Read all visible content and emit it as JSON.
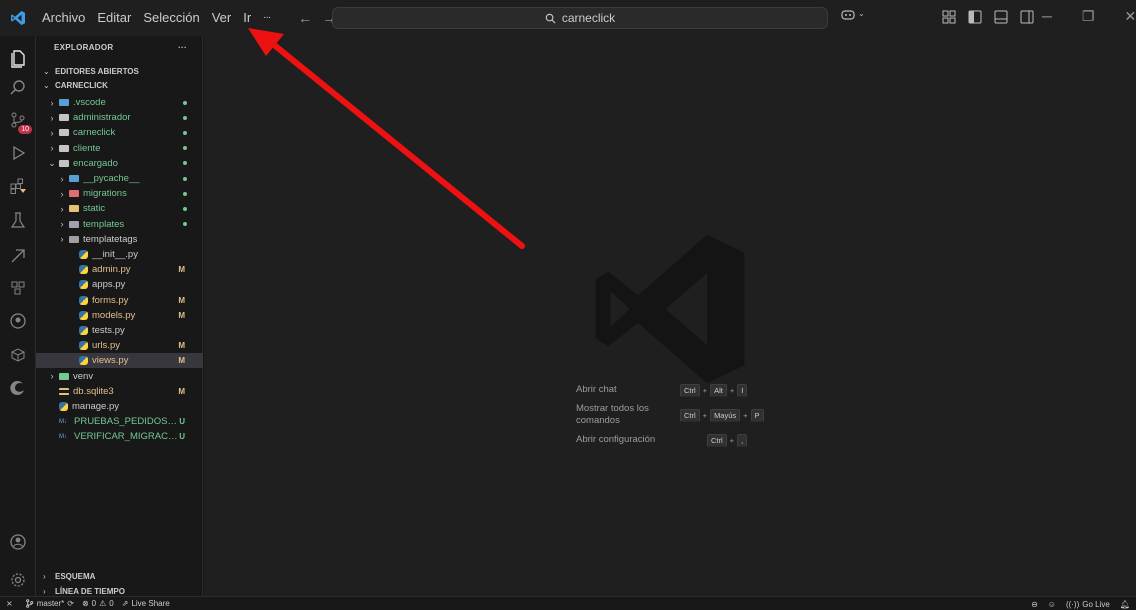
{
  "menu": [
    "Archivo",
    "Editar",
    "Selección",
    "Ver",
    "Ir"
  ],
  "menu_more": "···",
  "nav": {
    "back": "←",
    "forward": "→"
  },
  "search": {
    "text": "carneclick"
  },
  "sidebar": {
    "header": "EXPLORADOR",
    "header_more": "···",
    "open_editors": "EDITORES ABIERTOS",
    "project": "CARNECLICK",
    "outline": "ESQUEMA",
    "timeline": "LÍNEA DE TIEMPO",
    "tree": [
      {
        "label": ".vscode",
        "kind": "folder",
        "color": "#5a9fd4",
        "indent": 0,
        "chev": "›",
        "dot": true
      },
      {
        "label": "administrador",
        "kind": "folder",
        "color": "#c5c5c5",
        "indent": 0,
        "chev": "›",
        "dot": true
      },
      {
        "label": "carneclick",
        "kind": "folder",
        "color": "#c5c5c5",
        "indent": 0,
        "chev": "›",
        "dot": true
      },
      {
        "label": "cliente",
        "kind": "folder",
        "color": "#c5c5c5",
        "indent": 0,
        "chev": "›",
        "dot": true
      },
      {
        "label": "encargado",
        "kind": "folder-open",
        "color": "#c5c5c5",
        "indent": 0,
        "chev": "⌄",
        "dot": true
      },
      {
        "label": "__pycache__",
        "kind": "folder",
        "color": "#5a9fd4",
        "indent": 1,
        "chev": "›",
        "dot": true
      },
      {
        "label": "migrations",
        "kind": "folder",
        "color": "#e06c75",
        "indent": 1,
        "chev": "›",
        "dot": true
      },
      {
        "label": "static",
        "kind": "folder",
        "color": "#e5c07b",
        "indent": 1,
        "chev": "›",
        "dot": true
      },
      {
        "label": "templates",
        "kind": "folder",
        "color": "#a0a0b0",
        "indent": 1,
        "chev": "›",
        "dot": true
      },
      {
        "label": "templatetags",
        "kind": "folder",
        "color": "#a0a0a0",
        "indent": 1,
        "chev": "›",
        "dot": false,
        "plain": true
      },
      {
        "label": "__init__.py",
        "kind": "py",
        "indent": 2,
        "chev": "",
        "plain": true
      },
      {
        "label": "admin.py",
        "kind": "py",
        "indent": 2,
        "chev": "",
        "status": "M"
      },
      {
        "label": "apps.py",
        "kind": "py",
        "indent": 2,
        "chev": "",
        "plain": true
      },
      {
        "label": "forms.py",
        "kind": "py",
        "indent": 2,
        "chev": "",
        "status": "M"
      },
      {
        "label": "models.py",
        "kind": "py",
        "indent": 2,
        "chev": "",
        "status": "M"
      },
      {
        "label": "tests.py",
        "kind": "py",
        "indent": 2,
        "chev": "",
        "plain": true
      },
      {
        "label": "urls.py",
        "kind": "py",
        "indent": 2,
        "chev": "",
        "status": "M"
      },
      {
        "label": "views.py",
        "kind": "py",
        "indent": 2,
        "chev": "",
        "status": "M",
        "selected": true
      },
      {
        "label": "venv",
        "kind": "folder",
        "color": "#73c991",
        "indent": 0,
        "chev": "›",
        "dot": false,
        "plain": true
      },
      {
        "label": "db.sqlite3",
        "kind": "db",
        "indent": 0,
        "chev": "",
        "status": "M"
      },
      {
        "label": "manage.py",
        "kind": "py",
        "indent": 0,
        "chev": "",
        "plain": true
      },
      {
        "label": "PRUEBAS_PEDIDOS.md",
        "kind": "md",
        "indent": 0,
        "chev": "",
        "status": "U",
        "green": true
      },
      {
        "label": "VERIFICAR_MIGRACION...",
        "kind": "md",
        "indent": 0,
        "chev": "",
        "status": "U",
        "green": true
      }
    ]
  },
  "shortcuts": [
    {
      "label": "Abrir chat",
      "keys": [
        "Ctrl",
        "Alt",
        "I"
      ]
    },
    {
      "label": "Mostrar todos los comandos",
      "keys": [
        "Ctrl",
        "Mayús",
        "P"
      ]
    },
    {
      "label": "Abrir configuración",
      "keys": [
        "Ctrl",
        ","
      ]
    }
  ],
  "status": {
    "branch": "master*",
    "errors": "0",
    "warnings": "0",
    "live_share": "Live Share",
    "go_live": "Go Live",
    "scm_badge": "10"
  }
}
